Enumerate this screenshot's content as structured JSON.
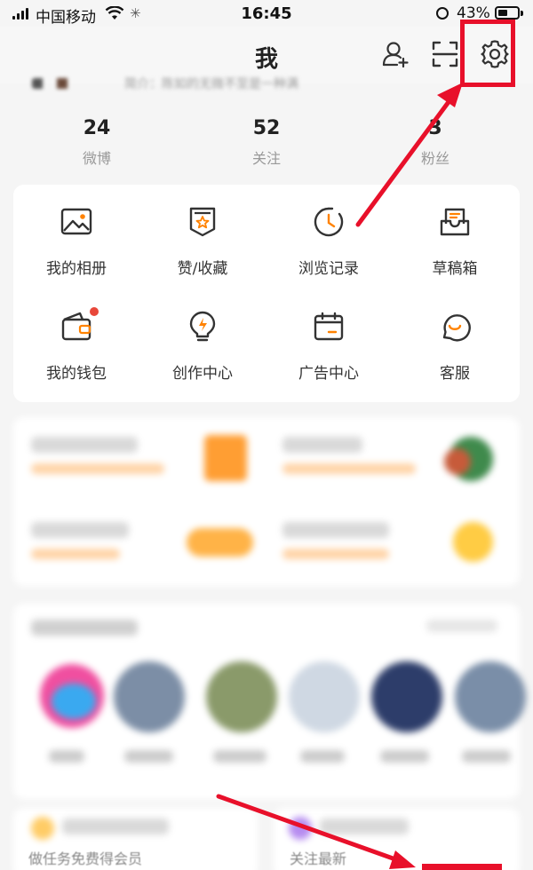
{
  "status_bar": {
    "carrier": "中国移动",
    "time": "16:45",
    "battery": "43%"
  },
  "header": {
    "title": "我"
  },
  "profile": {
    "snippet": "简介：陈如的无微不至是一种满"
  },
  "stats": [
    {
      "value": "24",
      "label": "微博"
    },
    {
      "value": "52",
      "label": "关注"
    },
    {
      "value": "3",
      "label": "粉丝"
    }
  ],
  "tools": [
    {
      "label": "我的相册",
      "icon": "album-icon"
    },
    {
      "label": "赞/收藏",
      "icon": "favorites-icon"
    },
    {
      "label": "浏览记录",
      "icon": "history-icon"
    },
    {
      "label": "草稿箱",
      "icon": "drafts-icon"
    },
    {
      "label": "我的钱包",
      "icon": "wallet-icon"
    },
    {
      "label": "创作中心",
      "icon": "creator-icon"
    },
    {
      "label": "广告中心",
      "icon": "ad-center-icon"
    },
    {
      "label": "客服",
      "icon": "customer-service-icon"
    }
  ],
  "bottom": {
    "left": "做任务免费得会员",
    "right": "关注最新"
  },
  "colors": {
    "accent": "#ff8200",
    "highlight": "#e8102a"
  }
}
